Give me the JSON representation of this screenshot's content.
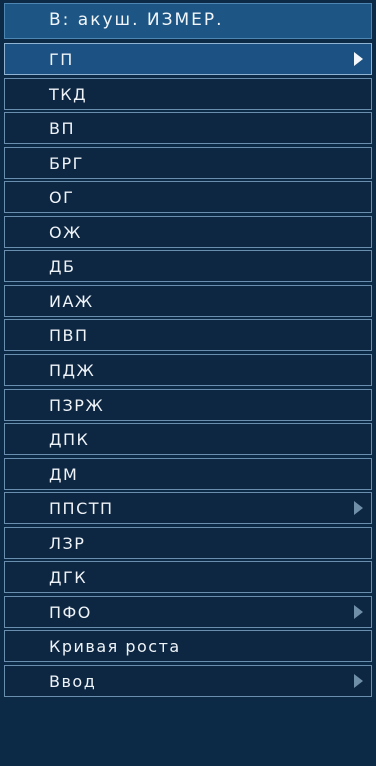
{
  "menu": {
    "title": "B: акуш. ИЗМЕР.",
    "items": [
      {
        "label": "ГП",
        "has_submenu": true,
        "selected": true
      },
      {
        "label": "ТКД",
        "has_submenu": false,
        "selected": false
      },
      {
        "label": "ВП",
        "has_submenu": false,
        "selected": false
      },
      {
        "label": "БРГ",
        "has_submenu": false,
        "selected": false
      },
      {
        "label": "ОГ",
        "has_submenu": false,
        "selected": false
      },
      {
        "label": "ОЖ",
        "has_submenu": false,
        "selected": false
      },
      {
        "label": "ДБ",
        "has_submenu": false,
        "selected": false
      },
      {
        "label": "ИАЖ",
        "has_submenu": false,
        "selected": false
      },
      {
        "label": "ПВП",
        "has_submenu": false,
        "selected": false
      },
      {
        "label": "ПДЖ",
        "has_submenu": false,
        "selected": false
      },
      {
        "label": "ПЗРЖ",
        "has_submenu": false,
        "selected": false
      },
      {
        "label": "ДПК",
        "has_submenu": false,
        "selected": false
      },
      {
        "label": "ДМ",
        "has_submenu": false,
        "selected": false
      },
      {
        "label": "ППСТП",
        "has_submenu": true,
        "selected": false
      },
      {
        "label": "ЛЗР",
        "has_submenu": false,
        "selected": false
      },
      {
        "label": "ДГК",
        "has_submenu": false,
        "selected": false
      },
      {
        "label": "ПФО",
        "has_submenu": true,
        "selected": false
      },
      {
        "label": "Кривая роста",
        "has_submenu": false,
        "selected": false
      },
      {
        "label": "Ввод",
        "has_submenu": true,
        "selected": false
      }
    ]
  },
  "colors": {
    "background": "#0c2a45",
    "header": "#1d5684",
    "selected": "#1c5283",
    "border": "#6a8fae",
    "text": "#eef3f8"
  }
}
